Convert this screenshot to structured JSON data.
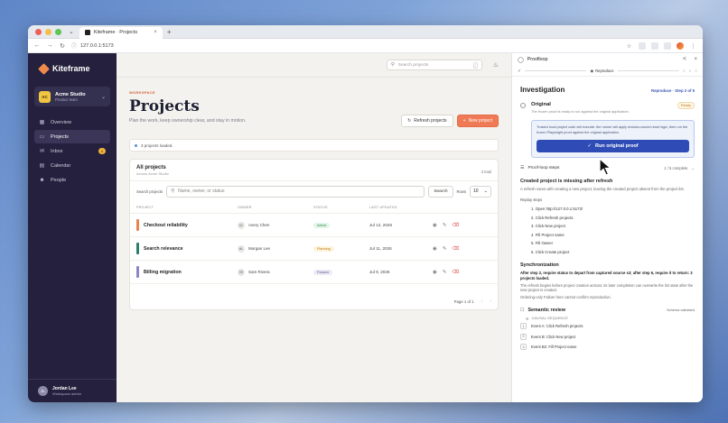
{
  "browser": {
    "tab_title": "Kiteframe · Projects",
    "url": "127.0.0.1:5173"
  },
  "sidebar": {
    "brand": "Kiteframe",
    "workspace": {
      "badge": "AC",
      "name": "Acme Studio",
      "sub": "Product team"
    },
    "items": [
      {
        "label": "Overview",
        "icon": "grid-icon"
      },
      {
        "label": "Projects",
        "icon": "folder-icon"
      },
      {
        "label": "Inbox",
        "icon": "inbox-icon",
        "badge": "4"
      },
      {
        "label": "Calendar",
        "icon": "calendar-icon"
      },
      {
        "label": "People",
        "icon": "people-icon"
      }
    ],
    "user": {
      "initials": "JL",
      "name": "Jordan Lee",
      "role": "Workspace admin"
    }
  },
  "topbar": {
    "search_placeholder": "Search projects",
    "search_kbd": "/"
  },
  "header": {
    "eyebrow": "WORKSPACE",
    "title": "Projects",
    "subtitle": "Plan the work, keep ownership clear, and stay in motion.",
    "refresh_label": "Refresh projects",
    "new_label": "New project"
  },
  "status_text": "3 projects loaded.",
  "projects_card": {
    "title": "All projects",
    "subtitle": "Across Acme Studio",
    "count": "3 total",
    "filter_label": "Search projects",
    "filter_placeholder": "Name, owner, or status",
    "search_button": "Search",
    "rows_label": "Rows",
    "rows_value": "10",
    "columns": [
      "PROJECT",
      "OWNER",
      "STATUS",
      "LAST UPDATED"
    ],
    "rows": [
      {
        "name": "Checkout reliability",
        "color": "#e8834f",
        "owner_initials": "AC",
        "owner": "Avery Chen",
        "status": "Active",
        "status_bg": "#e4f5e8",
        "status_fg": "#2f8a4a",
        "updated": "Jul 12, 2026"
      },
      {
        "name": "Search relevance",
        "color": "#2f7d6b",
        "owner_initials": "ML",
        "owner": "Morgan Lee",
        "status": "Planning",
        "status_bg": "#fff3dc",
        "status_fg": "#b97814",
        "updated": "Jul 11, 2026"
      },
      {
        "name": "Billing migration",
        "color": "#8a86c4",
        "owner_initials": "SR",
        "owner": "Sam Rivera",
        "status": "Paused",
        "status_bg": "#eceaf6",
        "status_fg": "#5d5a8a",
        "updated": "Jul 9, 2026"
      }
    ],
    "pagination": "Page 1 of 1"
  },
  "panel": {
    "title": "Proofloop",
    "tab_label": "Reproduce",
    "investigation_title": "Investigation",
    "step_indicator": "Reproduce · Step 2 of 5",
    "original_title": "Original",
    "original_sub": "The frozen proof is ready to run against the original application.",
    "ready_badge": "Ready",
    "callout_text": "Trusted local project code will execute: the runner will apply revision-owned reset logic, then run the frozen Playwright proof against the original application.",
    "run_button": "Run original proof",
    "steps_title": "Proof-loop steps",
    "steps_count": "1 / 5 complete",
    "issue_title": "Created project is missing after refresh",
    "issue_body": "A refresh races with creating a new project, leaving the created project absent from the project list.",
    "repro_label": "Replay steps",
    "repro_steps": [
      "1. Open http://127.0.0.1:5173/",
      "2. Click Refresh projects",
      "3. Click New project",
      "4. Fill Project name",
      "5. Fill Owner",
      "6. Click Create project"
    ],
    "sync_title": "Synchronization",
    "sync_bold": "After step 2, require status to depart from captured source s3; after step 6, require it to return: 3 projects loaded.",
    "sync_body1": "The refresh begins before project creation actions; its later completion can overwrite the list state after the new project is created.",
    "sync_body2": "Ordering-only Failure here cannot confirm reproduction.",
    "semantic_title": "Semantic review",
    "semantic_status": "Schema validated",
    "causal_label": "CAUSAL SEQUENCE",
    "events": [
      {
        "num": "1",
        "text": "Event A: Click Refresh projects"
      },
      {
        "num": "2",
        "text": "Event B: Click New project"
      },
      {
        "num": "3",
        "text": "Event B2: Fill Project name"
      }
    ]
  }
}
